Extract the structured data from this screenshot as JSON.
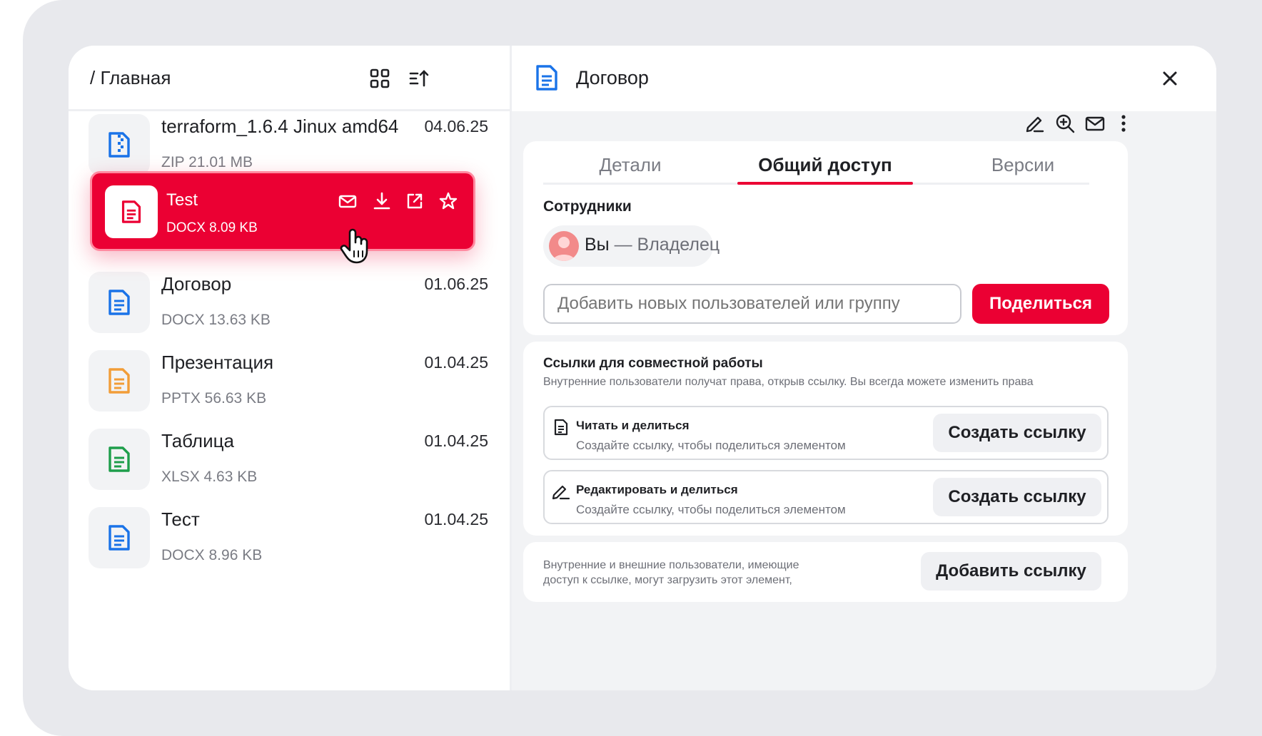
{
  "colors": {
    "accent": "#eb0033",
    "doc_blue": "#1a73e8",
    "pptx_orange": "#f29d38",
    "xlsx_green": "#1e9e4b"
  },
  "left": {
    "breadcrumb": "/ Главная",
    "icons": [
      "grid-view-icon",
      "sort-icon"
    ],
    "files": [
      {
        "name": "terraform_1.6.4 Jinux amd64",
        "meta": "ZIP 21.01 MB",
        "date": "04.06.25",
        "icon": "zip-file-icon"
      },
      {
        "name": "Договор",
        "meta": "DOCX 13.63 KB",
        "date": "01.06.25",
        "icon": "doc-file-icon"
      },
      {
        "name": "Презентация",
        "meta": "PPTX 56.63 KB",
        "date": "01.04.25",
        "icon": "pptx-file-icon"
      },
      {
        "name": "Таблица",
        "meta": "XLSX 4.63 KB",
        "date": "01.04.25",
        "icon": "xlsx-file-icon"
      },
      {
        "name": "Тест",
        "meta": "DOCX 8.96 KB",
        "date": "01.04.25",
        "icon": "doc-file-icon"
      }
    ],
    "dragged": {
      "name": "Test",
      "meta": "DOCX 8.09 KB",
      "actions": [
        "mail-icon",
        "download-icon",
        "open-external-icon",
        "star-icon"
      ]
    }
  },
  "right": {
    "title": "Договор",
    "toolbar": [
      "edit-icon",
      "zoom-in-icon",
      "mail-icon",
      "more-icon"
    ],
    "tabs": [
      {
        "label": "Детали",
        "active": false
      },
      {
        "label": "Общий доступ",
        "active": true
      },
      {
        "label": "Версии",
        "active": false
      }
    ],
    "employees": {
      "heading": "Сотрудники",
      "owner_you": "Вы",
      "owner_role": " — Владелец",
      "input_placeholder": "Добавить новых пользователей или группу",
      "share_button": "Поделиться"
    },
    "links": {
      "heading": "Ссылки для совместной работы",
      "description": "Внутренние пользователи получат права, открыв ссылку. Вы всегда можете изменить права",
      "rows": [
        {
          "title": "Читать и делиться",
          "subtitle": "Создайте ссылку, чтобы поделиться элементом",
          "button": "Создать ссылку"
        },
        {
          "title": "Редактировать и делиться",
          "subtitle": "Создайте ссылку, чтобы поделиться элементом",
          "button": "Создать ссылку"
        }
      ]
    },
    "external": {
      "text_line1": "Внутренние и внешние пользователи, имеющие",
      "text_line2": "доступ к ссылке, могут загрузить этот элемент,",
      "button": "Добавить ссылку"
    }
  }
}
